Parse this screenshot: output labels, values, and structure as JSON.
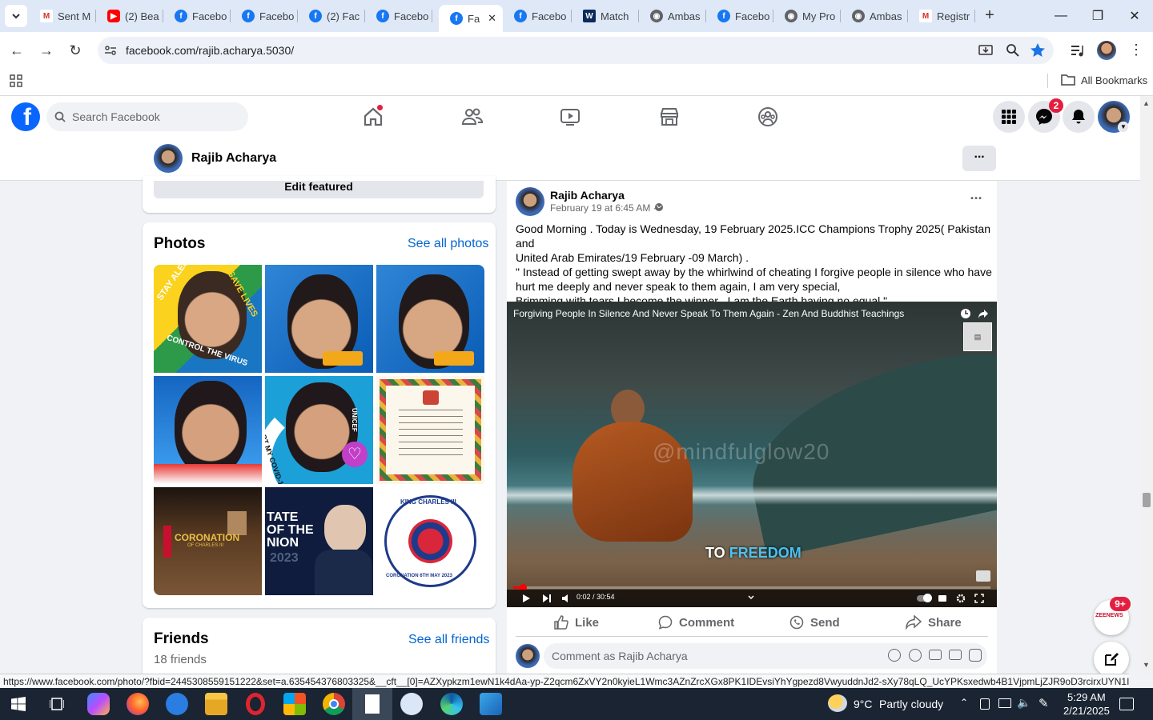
{
  "browser": {
    "tabs": [
      {
        "label": "Sent M",
        "icon": "gmail-icon"
      },
      {
        "label": "(2) Bea",
        "icon": "youtube-icon"
      },
      {
        "label": "Facebo",
        "icon": "facebook-icon"
      },
      {
        "label": "Facebo",
        "icon": "facebook-icon"
      },
      {
        "label": "(2) Fac",
        "icon": "facebook-icon"
      },
      {
        "label": "Facebo",
        "icon": "facebook-icon"
      },
      {
        "label": "Fa",
        "icon": "facebook-icon"
      },
      {
        "label": "Facebo",
        "icon": "facebook-icon"
      },
      {
        "label": "Match",
        "icon": "matchcenter-icon"
      },
      {
        "label": "Ambas",
        "icon": "globe-icon"
      },
      {
        "label": "Facebo",
        "icon": "facebook-icon"
      },
      {
        "label": "My Pro",
        "icon": "globe-icon"
      },
      {
        "label": "Ambas",
        "icon": "globe-icon"
      },
      {
        "label": "Registr",
        "icon": "gmail-icon"
      }
    ],
    "new_tab": "+",
    "url": "facebook.com/rajib.acharya.5030/",
    "all_bookmarks": "All Bookmarks",
    "status_url": "https://www.facebook.com/photo/?fbid=2445308559151222&set=a.635454376803325&__cft__[0]=AZXypkzm1ewN1k4dAa-yp-Z2qcm6ZxVY2n0kyieL1Wmc3AZnZrcXGx8PK1IDEvsiYhYgpezd8VwyuddnJd2-sXy78qLQ_UcYPKsxedwb4B1VjpmLjZJR9oD3rcirxUYN1IfAZ..."
  },
  "facebook": {
    "logo": "f",
    "search_placeholder": "Search Facebook",
    "messenger_badge": "2",
    "profile_name": "Rajib Acharya",
    "more_btn": "···",
    "edit_featured": "Edit featured",
    "photos_title": "Photos",
    "see_all_photos": "See all photos",
    "photo_captions": {
      "stay_alert": "STAY ALERT",
      "save_lives": "SAVE LIVES",
      "control_virus": "CONTROL THE VIRUS",
      "covid_vaccine": "I GOT MY COVID-19 VACCINE",
      "unicef": "UNICEF",
      "coronation": "CORONATION",
      "coronation_sub": "OF CHARLES III",
      "state_union": "TATE OF THE NION",
      "year": "2023",
      "king_charles": "KING CHARLES III",
      "coronation_date": "CORONATION 6TH MAY 2023"
    },
    "friends_title": "Friends",
    "see_all_friends": "See all friends",
    "friends_count": "18 friends",
    "post": {
      "author": "Rajib Acharya",
      "time": "February 19 at 6:45 AM ·",
      "line1": "Good Morning . Today is Wednesday, 19 February 2025.ICC Champions Trophy 2025( Pakistan and",
      "line2": "United Arab Emirates/19 February -09 March) .",
      "line3": "\" Instead of getting swept away by the whirlwind of cheating I  forgive people in silence who have",
      "line4": "hurt me deeply and never speak to them again, I am very special,",
      "line5": "Brimming with tears I become the winner ,  I am the Earth having no equal.\"",
      "video_title": "Forgiving People In Silence And Never Speak To Them Again - Zen And Buddhist Teachings",
      "watermark": "@mindfulglow20",
      "caption_to": "TO",
      "caption_freedom": "FREEDOM",
      "video_time": "0:02 / 30:54",
      "video_progress": 0.02,
      "like": "Like",
      "comment": "Comment",
      "send": "Send",
      "share": "Share",
      "comment_placeholder": "Comment as Rajib Acharya"
    },
    "news_badge": "9+",
    "news_label": "ZEENEWS"
  },
  "taskbar": {
    "weather_temp": "9°C",
    "weather_text": "Partly cloudy",
    "time": "5:29 AM",
    "date": "2/21/2025"
  }
}
